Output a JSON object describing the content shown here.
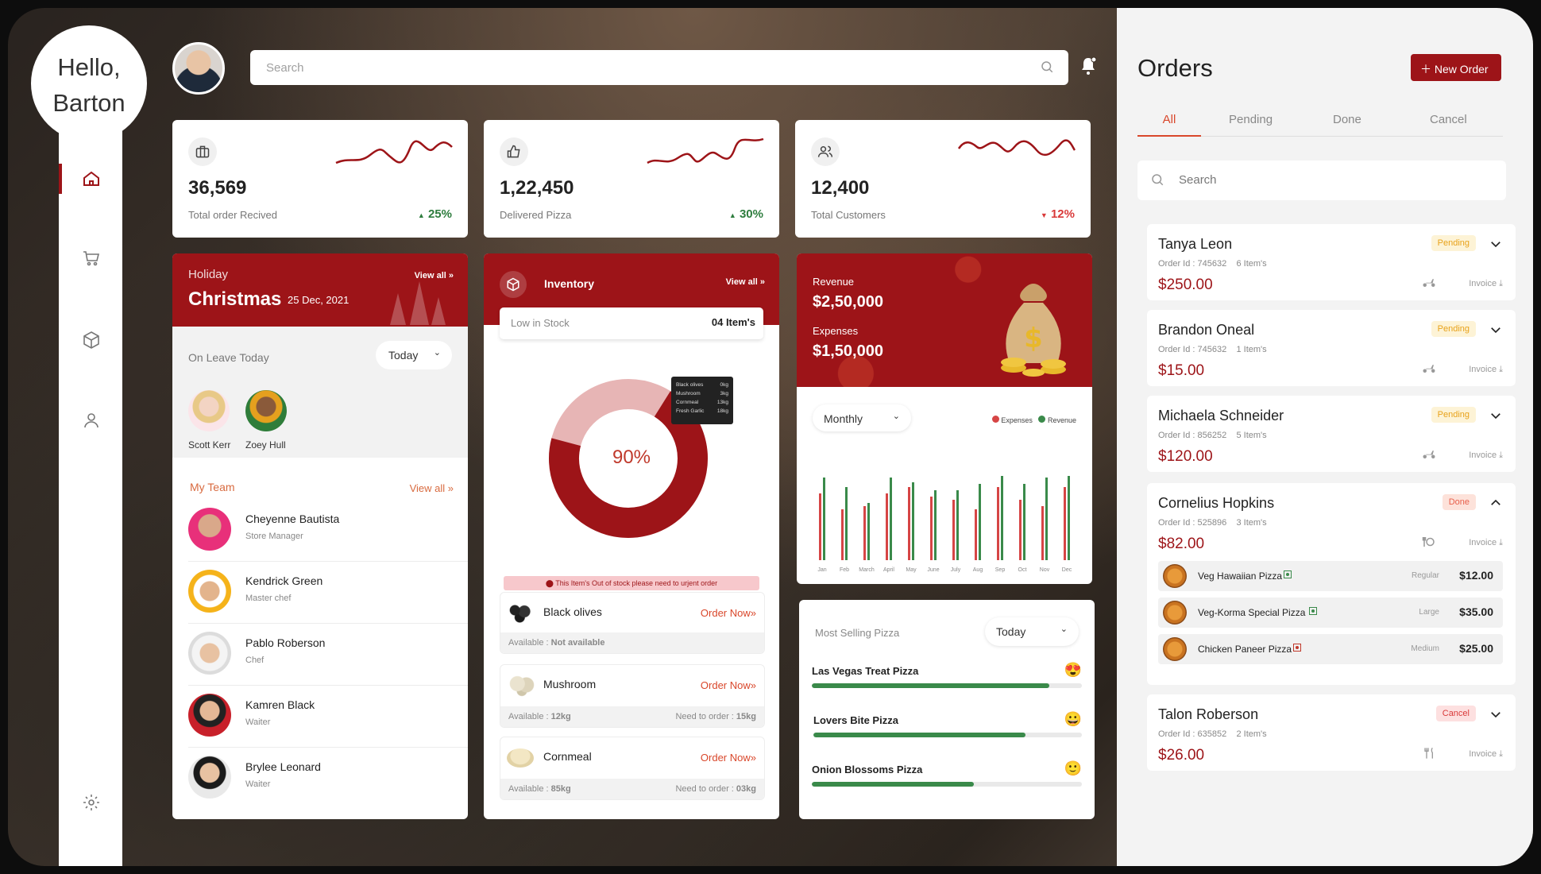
{
  "greeting": {
    "line1": "Hello,",
    "line2": "Barton"
  },
  "search": {
    "placeholder": "Search"
  },
  "stats": [
    {
      "value": "36,569",
      "label": "Total order Recived",
      "change": "25%",
      "direction": "up"
    },
    {
      "value": "1,22,450",
      "label": "Delivered Pizza",
      "change": "30%",
      "direction": "up"
    },
    {
      "value": "12,400",
      "label": "Total Customers",
      "change": "12%",
      "direction": "down"
    }
  ],
  "holiday": {
    "label": "Holiday",
    "name": "Christmas",
    "date": "25 Dec, 2021",
    "view_all": "View all",
    "on_leave_label": "On Leave Today",
    "filter": "Today",
    "on_leave": [
      {
        "name": "Scott Kerr"
      },
      {
        "name": "Zoey Hull"
      }
    ]
  },
  "team": {
    "title": "My Team",
    "view_all": "View all",
    "members": [
      {
        "name": "Cheyenne Bautista",
        "role": "Store Manager"
      },
      {
        "name": "Kendrick Green",
        "role": "Master chef"
      },
      {
        "name": "Pablo Roberson",
        "role": "Chef"
      },
      {
        "name": "Kamren Black",
        "role": "Waiter"
      },
      {
        "name": "Brylee Leonard",
        "role": "Waiter"
      }
    ]
  },
  "inventory": {
    "title": "Inventory",
    "view_all": "View all",
    "low_stock_label": "Low in Stock",
    "low_stock_count": "04 Item's",
    "percent": "90%",
    "donut_fraction": 0.9,
    "tooltip": [
      {
        "name": "Black olives",
        "qty": "0kg"
      },
      {
        "name": "Mushroom",
        "qty": "3kg"
      },
      {
        "name": "Cornmeal",
        "qty": "13kg"
      },
      {
        "name": "Fresh Garlic",
        "qty": "18kg"
      }
    ],
    "alert": "This Item's Out of stock please need to urjent order",
    "items": [
      {
        "name": "Black olives",
        "action": "Order Now",
        "available_label": "Available",
        "available": "Not available",
        "need_label": "",
        "need": ""
      },
      {
        "name": "Mushroom",
        "action": "Order Now",
        "available_label": "Available",
        "available": "12kg",
        "need_label": "Need to order",
        "need": "15kg"
      },
      {
        "name": "Cornmeal",
        "action": "Order Now",
        "available_label": "Available",
        "available": "85kg",
        "need_label": "Need to order",
        "need": "03kg"
      }
    ]
  },
  "revenue": {
    "revenue_label": "Revenue",
    "revenue": "$2,50,000",
    "expenses_label": "Expenses",
    "expenses": "$1,50,000",
    "filter": "Monthly",
    "legend": [
      {
        "name": "Expenses",
        "color": "#d64545"
      },
      {
        "name": "Revenue",
        "color": "#3a8a4a"
      }
    ]
  },
  "chart_data": {
    "type": "bar",
    "categories": [
      "Jan",
      "Feb",
      "March",
      "April",
      "May",
      "June",
      "July",
      "Aug",
      "Sep",
      "Oct",
      "Nov",
      "Dec"
    ],
    "series": [
      {
        "name": "Expenses",
        "values": [
          42,
          32,
          34,
          42,
          46,
          40,
          38,
          32,
          46,
          38,
          34,
          46
        ]
      },
      {
        "name": "Revenue",
        "values": [
          52,
          46,
          36,
          52,
          49,
          44,
          44,
          48,
          53,
          48,
          52,
          53
        ]
      }
    ],
    "ylim": [
      0,
      60
    ],
    "colors": {
      "Expenses": "#d64545",
      "Revenue": "#3a8a4a"
    }
  },
  "selling": {
    "title": "Most Selling Pizza",
    "filter": "Today",
    "items": [
      {
        "name": "Las Vegas Treat Pizza",
        "emoji": "😍",
        "progress": 0.88
      },
      {
        "name": "Lovers Bite Pizza",
        "emoji": "😀",
        "progress": 0.79
      },
      {
        "name": "Onion Blossoms Pizza",
        "emoji": "🙂",
        "progress": 0.6
      }
    ]
  },
  "orders": {
    "title": "Orders",
    "new_order": "New Order",
    "tabs": [
      "All",
      "Pending",
      "Done",
      "Cancel"
    ],
    "active_tab": "All",
    "search": "Search",
    "invoice": "Invoice",
    "list": [
      {
        "name": "Tanya Leon",
        "order_id": "Order Id : 745632",
        "items": "6 Item's",
        "price": "$250.00",
        "status": "Pending"
      },
      {
        "name": "Brandon Oneal",
        "order_id": "Order Id : 745632",
        "items": "1 Item's",
        "price": "$15.00",
        "status": "Pending"
      },
      {
        "name": "Michaela Schneider",
        "order_id": "Order Id : 856252",
        "items": "5 Item's",
        "price": "$120.00",
        "status": "Pending"
      },
      {
        "name": "Cornelius Hopkins",
        "order_id": "Order Id : 525896",
        "items": "3 Item's",
        "price": "$82.00",
        "status": "Done",
        "details": [
          {
            "name": "Veg Hawaiian Pizza",
            "size": "Regular",
            "price": "$12.00"
          },
          {
            "name": "Veg-Korma Special Pizza",
            "size": "Large",
            "price": "$35.00"
          },
          {
            "name": "Chicken Paneer Pizza",
            "size": "Medium",
            "price": "$25.00"
          }
        ]
      },
      {
        "name": "Talon Roberson",
        "order_id": "Order Id : 635852",
        "items": "2 Item's",
        "price": "$26.00",
        "status": "Cancel"
      }
    ]
  },
  "colors": {
    "brand": "#9d1418",
    "pending": "#f5a623",
    "done": "#e8604c",
    "cancel": "#d93a3a",
    "green": "#3a8a4a"
  }
}
